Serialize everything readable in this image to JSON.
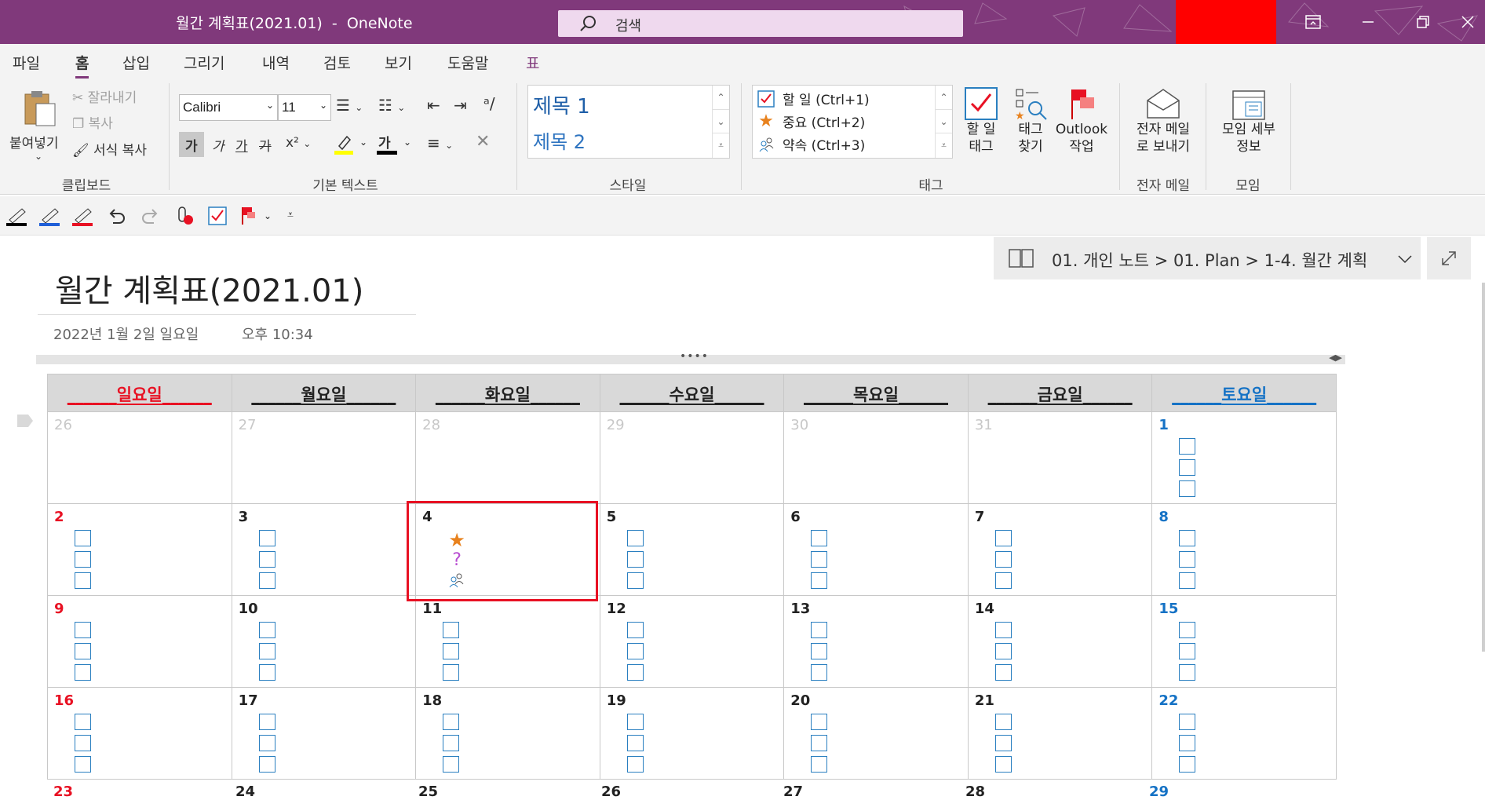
{
  "window": {
    "title": "월간 계획표(2021.01)  -  OneNote",
    "search_placeholder": "검색"
  },
  "menu_tabs": [
    "파일",
    "홈",
    "삽입",
    "그리기",
    "내역",
    "검토",
    "보기",
    "도움말",
    "표"
  ],
  "ribbon": {
    "clipboard": {
      "paste": "붙여넣기",
      "cut": "잘라내기",
      "copy": "복사",
      "format_painter": "서식 복사",
      "group_label": "클립보드"
    },
    "basic_text": {
      "font": "Calibri",
      "size": "11",
      "bold": "가",
      "italic": "가",
      "underline": "가",
      "strike": "가",
      "superscript": "x²",
      "font_color": "가",
      "group_label": "기본 텍스트"
    },
    "styles": {
      "heading1": "제목 1",
      "heading2": "제목 2",
      "group_label": "스타일"
    },
    "tags": {
      "items": [
        "할 일 (Ctrl+1)",
        "중요 (Ctrl+2)",
        "약속 (Ctrl+3)"
      ],
      "todo_tag": "할 일\n태그",
      "find_tags": "태그\n찾기",
      "outlook": "Outlook\n작업",
      "group_label": "태그"
    },
    "email": {
      "send": "전자 메일\n로 보내기",
      "group_label": "전자 메일"
    },
    "meetings": {
      "details": "모임 세부\n정보",
      "group_label": "모임"
    }
  },
  "breadcrumb": "01. 개인 노트 > 01. Plan > 1-4. 월간 계획",
  "page": {
    "title": "월간 계획표(2021.01)",
    "date": "2022년 1월 2일 일요일",
    "time": "오후 10:34"
  },
  "calendar": {
    "headers": [
      "일요일",
      "월요일",
      "화요일",
      "수요일",
      "목요일",
      "금요일",
      "토요일"
    ],
    "weeks": [
      [
        "26",
        "27",
        "28",
        "29",
        "30",
        "31",
        "1"
      ],
      [
        "2",
        "3",
        "4",
        "5",
        "6",
        "7",
        "8"
      ],
      [
        "9",
        "10",
        "11",
        "12",
        "13",
        "14",
        "15"
      ],
      [
        "16",
        "17",
        "18",
        "19",
        "20",
        "21",
        "22"
      ]
    ],
    "partial_week": [
      "23",
      "24",
      "25",
      "26",
      "27",
      "28",
      "29"
    ]
  },
  "colors": {
    "titlebar": "#80397b",
    "sunday": "#e81123",
    "saturday": "#1572c5",
    "checkbox": "#2a7fc0",
    "highlight": "#e81123"
  }
}
